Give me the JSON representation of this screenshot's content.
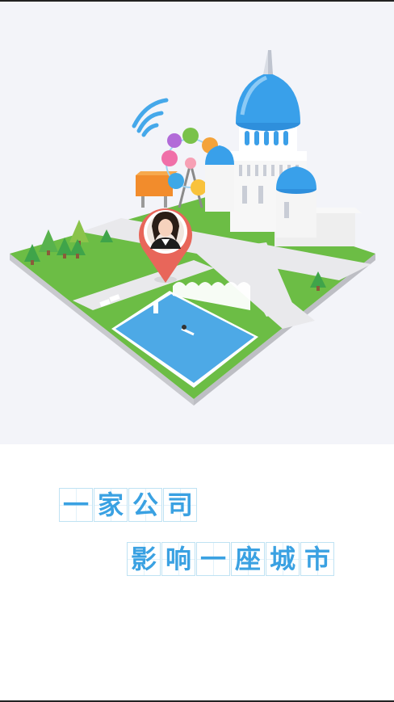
{
  "slogan": {
    "line1": [
      "一",
      "家",
      "公",
      "司"
    ],
    "line2": [
      "影",
      "响",
      "一",
      "座",
      "城",
      "市"
    ]
  },
  "illustration": {
    "icons": [
      "wifi-icon",
      "map-pin-icon",
      "ferris-wheel",
      "castle",
      "swimming-pool",
      "trees",
      "billboard"
    ],
    "colors": {
      "background": "#f3f4f9",
      "grass": "#6cbd45",
      "road": "#e6e6e6",
      "water": "#4da9e6",
      "pin": "#e8665a",
      "dome": "#39a0ea",
      "castle": "#f7f7f7",
      "slogan_text": "#3aa1e2"
    }
  }
}
